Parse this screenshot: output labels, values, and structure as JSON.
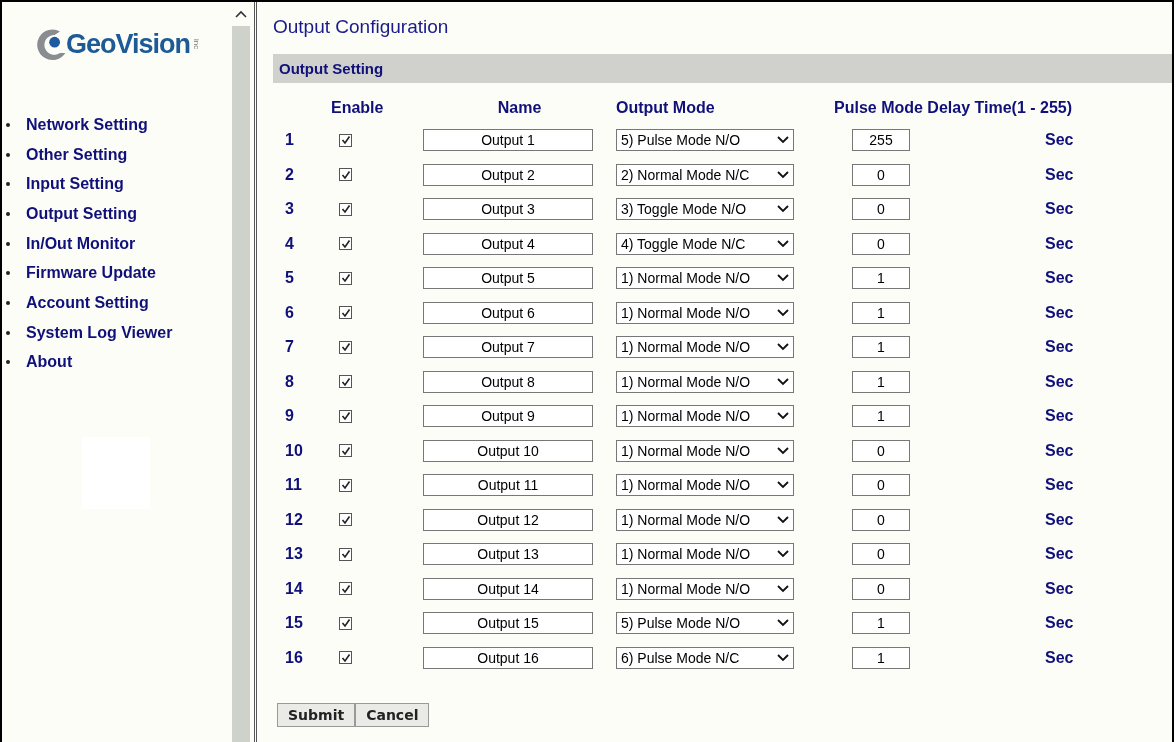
{
  "logo": {
    "text": "GeoVision",
    "suffix": "inc"
  },
  "sidebar": {
    "items": [
      {
        "label": "Network Setting"
      },
      {
        "label": "Other Setting"
      },
      {
        "label": "Input Setting"
      },
      {
        "label": "Output Setting"
      },
      {
        "label": "In/Out Monitor"
      },
      {
        "label": "Firmware Update"
      },
      {
        "label": "Account Setting"
      },
      {
        "label": "System Log Viewer"
      },
      {
        "label": "About"
      }
    ]
  },
  "page_title": "Output Configuration",
  "section_title": "Output Setting",
  "columns": [
    "Enable",
    "Name",
    "Output Mode",
    "Pulse Mode Delay Time(1 - 255)"
  ],
  "rows": [
    {
      "number": "1",
      "enabled": true,
      "name": "Output 1",
      "mode": "5) Pulse Mode N/O",
      "delay": "255",
      "unit": "Sec"
    },
    {
      "number": "2",
      "enabled": true,
      "name": "Output 2",
      "mode": "2) Normal Mode N/C",
      "delay": "0",
      "unit": "Sec"
    },
    {
      "number": "3",
      "enabled": true,
      "name": "Output 3",
      "mode": "3) Toggle Mode N/O",
      "delay": "0",
      "unit": "Sec"
    },
    {
      "number": "4",
      "enabled": true,
      "name": "Output 4",
      "mode": "4) Toggle Mode N/C",
      "delay": "0",
      "unit": "Sec"
    },
    {
      "number": "5",
      "enabled": true,
      "name": "Output 5",
      "mode": "1) Normal Mode N/O",
      "delay": "1",
      "unit": "Sec"
    },
    {
      "number": "6",
      "enabled": true,
      "name": "Output 6",
      "mode": "1) Normal Mode N/O",
      "delay": "1",
      "unit": "Sec"
    },
    {
      "number": "7",
      "enabled": true,
      "name": "Output 7",
      "mode": "1) Normal Mode N/O",
      "delay": "1",
      "unit": "Sec"
    },
    {
      "number": "8",
      "enabled": true,
      "name": "Output 8",
      "mode": "1) Normal Mode N/O",
      "delay": "1",
      "unit": "Sec"
    },
    {
      "number": "9",
      "enabled": true,
      "name": "Output 9",
      "mode": "1) Normal Mode N/O",
      "delay": "1",
      "unit": "Sec"
    },
    {
      "number": "10",
      "enabled": true,
      "name": "Output 10",
      "mode": "1) Normal Mode N/O",
      "delay": "0",
      "unit": "Sec"
    },
    {
      "number": "11",
      "enabled": true,
      "name": "Output 11",
      "mode": "1) Normal Mode N/O",
      "delay": "0",
      "unit": "Sec"
    },
    {
      "number": "12",
      "enabled": true,
      "name": "Output 12",
      "mode": "1) Normal Mode N/O",
      "delay": "0",
      "unit": "Sec"
    },
    {
      "number": "13",
      "enabled": true,
      "name": "Output 13",
      "mode": "1) Normal Mode N/O",
      "delay": "0",
      "unit": "Sec"
    },
    {
      "number": "14",
      "enabled": true,
      "name": "Output 14",
      "mode": "1) Normal Mode N/O",
      "delay": "0",
      "unit": "Sec"
    },
    {
      "number": "15",
      "enabled": true,
      "name": "Output 15",
      "mode": "5) Pulse Mode N/O",
      "delay": "1",
      "unit": "Sec"
    },
    {
      "number": "16",
      "enabled": true,
      "name": "Output 16",
      "mode": "6) Pulse Mode N/C",
      "delay": "1",
      "unit": "Sec"
    }
  ],
  "buttons": [
    "Submit",
    "Cancel"
  ]
}
